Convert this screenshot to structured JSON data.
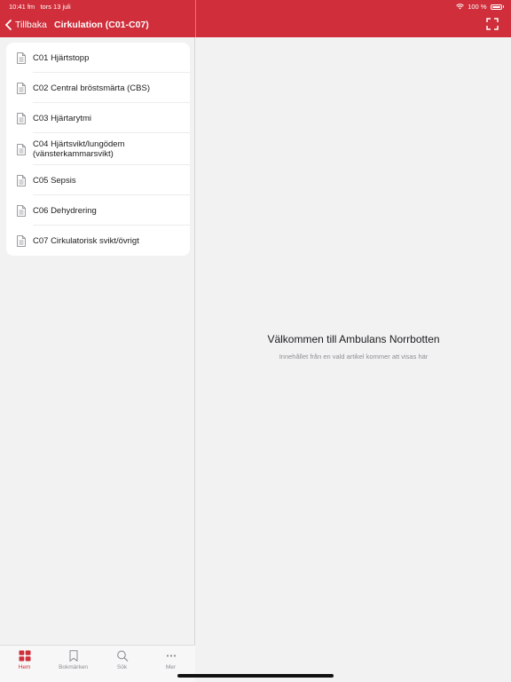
{
  "status_bar": {
    "time": "10:41 fm",
    "date": "tors 13 juli",
    "battery": "100 %"
  },
  "nav": {
    "back_label": "Tillbaka",
    "title": "Cirkulation (C01-C07)"
  },
  "list": {
    "items": [
      {
        "label": "C01 Hjärtstopp"
      },
      {
        "label": "C02 Central bröstsmärta (CBS)"
      },
      {
        "label": "C03 Hjärtarytmi"
      },
      {
        "label": "C04 Hjärtsvikt/lungödem\n(vänsterkammarsvikt)"
      },
      {
        "label": "C05 Sepsis"
      },
      {
        "label": "C06 Dehydrering"
      },
      {
        "label": "C07 Cirkulatorisk svikt/övrigt"
      }
    ]
  },
  "detail": {
    "title": "Välkommen till Ambulans Norrbotten",
    "subtitle": "Innehållet från en vald artikel kommer att visas här"
  },
  "tabbar": {
    "tabs": [
      {
        "label": "Hem",
        "icon": "grid-icon",
        "active": true
      },
      {
        "label": "Bokmärken",
        "icon": "bookmark-icon",
        "active": false
      },
      {
        "label": "Sök",
        "icon": "search-icon",
        "active": false
      },
      {
        "label": "Mer",
        "icon": "more-icon",
        "active": false
      }
    ]
  },
  "colors": {
    "accent": "#cf2e3a",
    "background": "#f2f2f3"
  }
}
